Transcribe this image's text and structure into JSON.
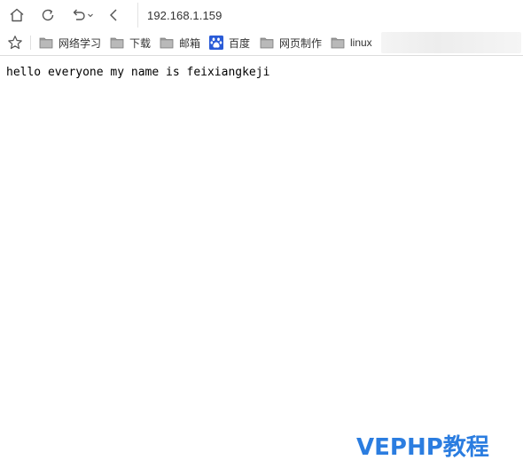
{
  "toolbar": {
    "address": "192.168.1.159"
  },
  "bookmarks": {
    "items": [
      {
        "label": "网络学习",
        "icon": "folder-icon"
      },
      {
        "label": "下载",
        "icon": "folder-icon"
      },
      {
        "label": "邮箱",
        "icon": "folder-icon"
      },
      {
        "label": "百度",
        "icon": "baidu-paw-icon"
      },
      {
        "label": "网页制作",
        "icon": "folder-icon"
      },
      {
        "label": "linux",
        "icon": "folder-icon"
      }
    ]
  },
  "page": {
    "body_text": "hello everyone my name is feixiangkeji"
  },
  "watermark": {
    "text": "VEPHP教程"
  },
  "colors": {
    "watermark": "#2b7de0",
    "baidu_icon": "#2a5bd7",
    "folder": "#8a8a8a"
  }
}
